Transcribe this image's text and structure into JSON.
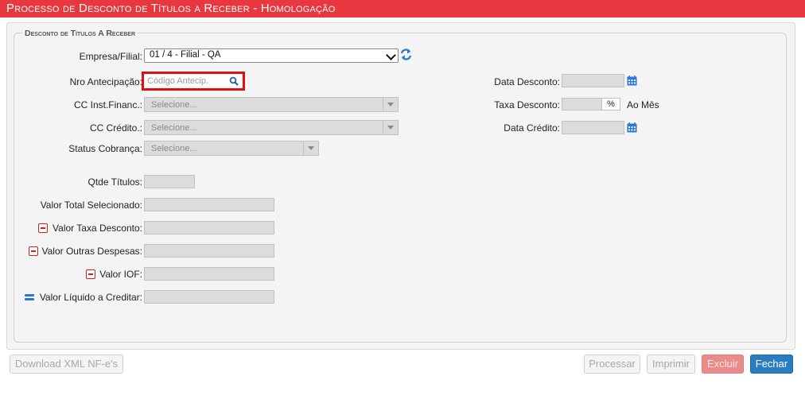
{
  "header": {
    "title": "Processo de Desconto de Títulos a Receber  - Homologação"
  },
  "section": {
    "legend": "Desconto de Títulos A Receber"
  },
  "form": {
    "empresa_label": "Empresa/Filial:",
    "empresa_value": "01 / 4 - Filial - QA",
    "nro_label": "Nro Antecipação:",
    "nro_placeholder": "Código Antecip.",
    "cc_inst_label": "CC Inst.Financ.:",
    "cc_inst_value": "Selecione...",
    "cc_credito_label": "CC Crédito.:",
    "cc_credito_value": "Selecione...",
    "status_label": "Status Cobrança:",
    "status_value": "Selecione...",
    "qtde_label": "Qtde Títulos:",
    "valor_total_label": "Valor Total Selecionado:",
    "valor_taxa_label": "Valor Taxa Desconto:",
    "valor_outras_label": "Valor Outras Despesas:",
    "valor_iof_label": "Valor IOF:",
    "valor_liquido_label": "Valor Líquido a Creditar:",
    "data_desconto_label": "Data Desconto:",
    "taxa_desconto_label": "Taxa Desconto:",
    "taxa_unit": "%",
    "taxa_suffix": "Ao Mês",
    "data_credito_label": "Data Crédito:"
  },
  "buttons": {
    "download": "Download XML NF-e's",
    "processar": "Processar",
    "imprimir": "Imprimir",
    "excluir": "Excluir",
    "fechar": "Fechar"
  },
  "icons": {
    "refresh": "refresh-icon",
    "search": "search-icon",
    "calendar": "calendar-icon",
    "minus": "minus-icon",
    "equals": "equals-icon"
  },
  "colors": {
    "title_bar": "#e8373f",
    "accent": "#2a78d6",
    "danger_outline": "#e01010"
  }
}
